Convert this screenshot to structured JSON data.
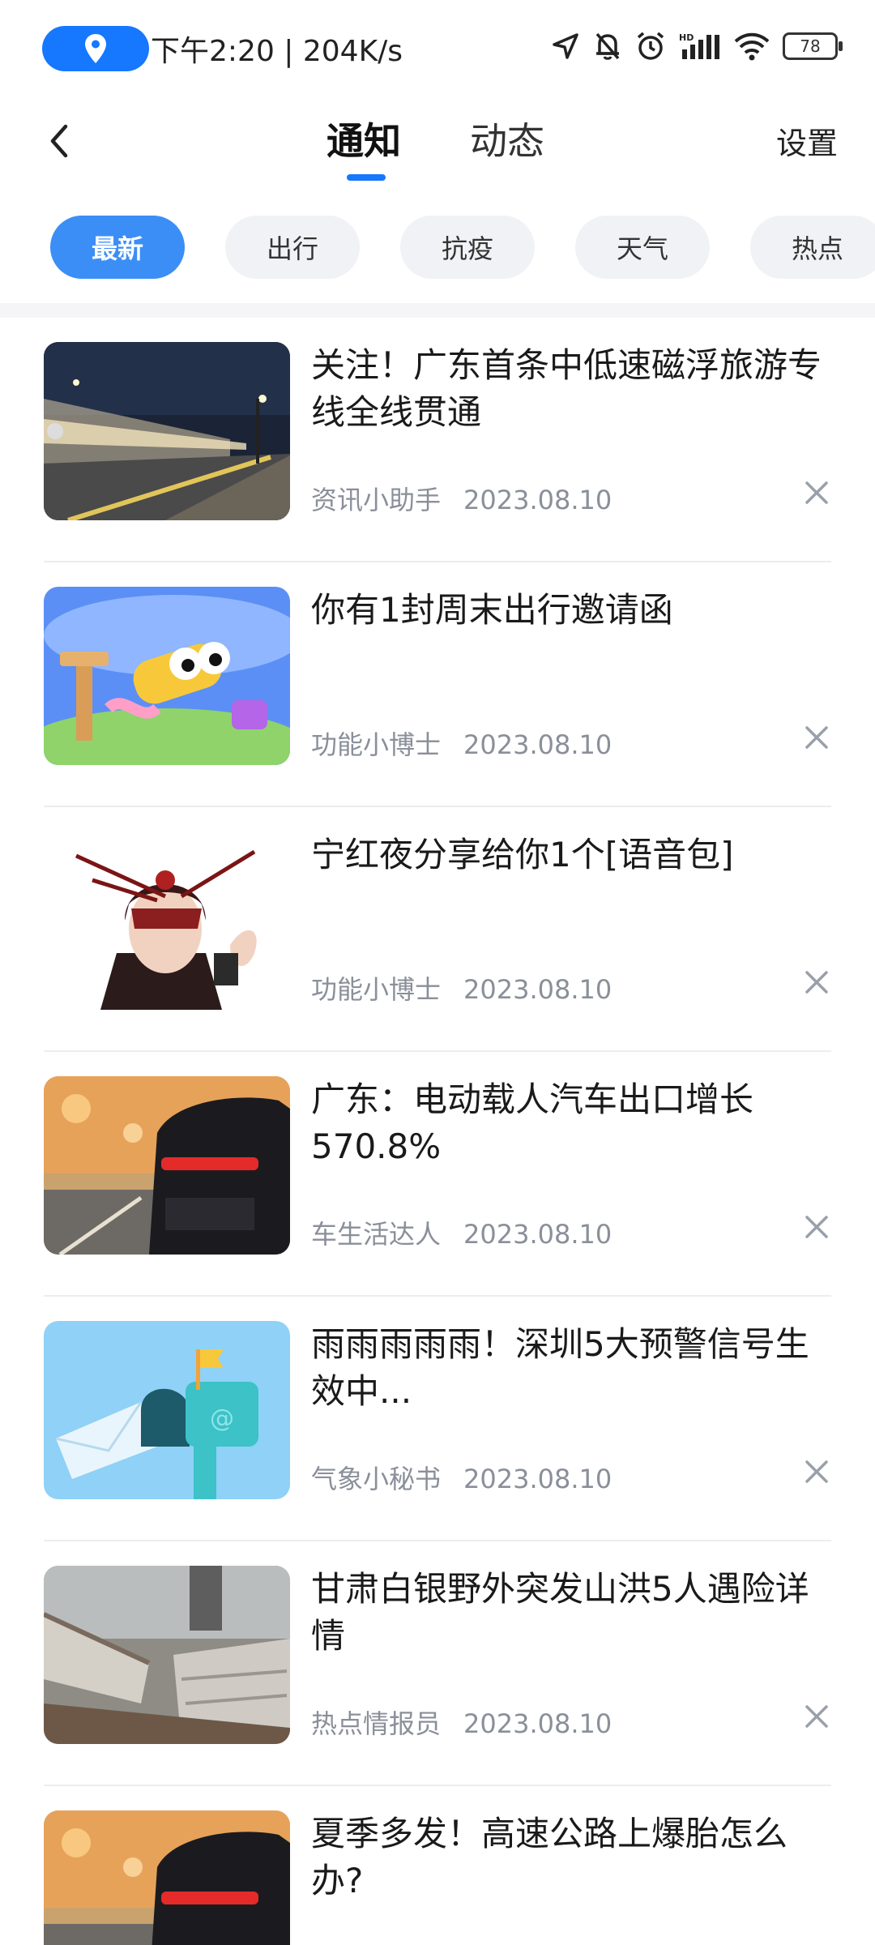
{
  "status_bar": {
    "time_speed": "下午2:20 | 204K/s",
    "battery": "78",
    "icons": [
      "location-icon",
      "navigation-arrow-icon",
      "mute-bell-icon",
      "alarm-icon",
      "hd-signal-icon",
      "wifi-icon",
      "battery-icon"
    ]
  },
  "header": {
    "tabs": [
      {
        "label": "通知",
        "active": true
      },
      {
        "label": "动态",
        "active": false
      }
    ],
    "settings_label": "设置",
    "accent_color": "#1677ff"
  },
  "chips": [
    {
      "label": "最新",
      "active": true
    },
    {
      "label": "出行",
      "active": false
    },
    {
      "label": "抗疫",
      "active": false
    },
    {
      "label": "天气",
      "active": false
    },
    {
      "label": "热点",
      "active": false
    }
  ],
  "items": [
    {
      "title": "关注！广东首条中低速磁浮旅游专线全线贯通",
      "source": "资讯小助手",
      "date": "2023.08.10",
      "image": "train-platform"
    },
    {
      "title": "你有1封周末出行邀请函",
      "source": "功能小博士",
      "date": "2023.08.10",
      "image": "cartoon-telescope"
    },
    {
      "title": "宁红夜分享给你1个[语音包]",
      "source": "功能小博士",
      "date": "2023.08.10",
      "image": "game-character"
    },
    {
      "title": "广东：电动载人汽车出口增长570.8%",
      "source": "车生活达人",
      "date": "2023.08.10",
      "image": "red-car"
    },
    {
      "title": "雨雨雨雨雨！深圳5大预警信号生效中...",
      "source": "气象小秘书",
      "date": "2023.08.10",
      "image": "mailbox"
    },
    {
      "title": "甘肃白银野外突发山洪5人遇险详情",
      "source": "热点情报员",
      "date": "2023.08.10",
      "image": "flood-damage"
    },
    {
      "title": "夏季多发！高速公路上爆胎怎么办?",
      "source": "",
      "date": "",
      "image": "red-car"
    }
  ]
}
